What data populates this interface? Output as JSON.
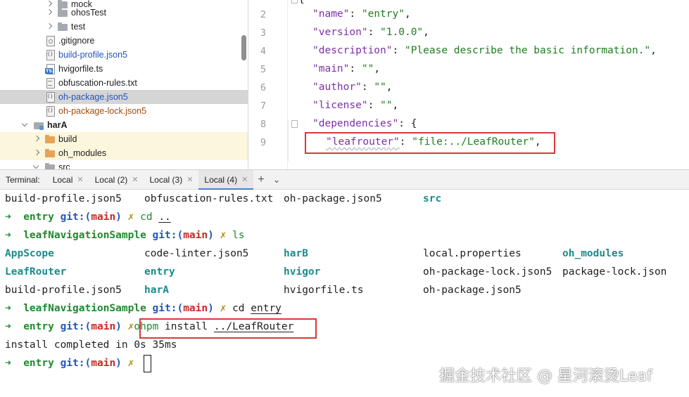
{
  "project_tree": {
    "items": [
      {
        "label": "mock",
        "icon": "folder-grey-icon",
        "arrow": "right",
        "indent": 1
      },
      {
        "label": "ohosTest",
        "icon": "folder-grey-icon",
        "arrow": "right",
        "indent": 1
      },
      {
        "label": "test",
        "icon": "folder-grey-icon",
        "arrow": "right",
        "indent": 1
      },
      {
        "label": ".gitignore",
        "icon": "gitignore-file-icon",
        "arrow": "none",
        "indent": 0
      },
      {
        "label": "build-profile.json5",
        "icon": "json-file-icon",
        "arrow": "none",
        "indent": 0
      },
      {
        "label": "hvigorfile.ts",
        "icon": "ts-file-icon",
        "arrow": "none",
        "indent": 0
      },
      {
        "label": "obfuscation-rules.txt",
        "icon": "text-file-icon",
        "arrow": "none",
        "indent": 0
      },
      {
        "label": "oh-package.json5",
        "icon": "json-file-icon",
        "arrow": "none",
        "indent": 0
      },
      {
        "label": "oh-package-lock.json5",
        "icon": "json-file-icon",
        "arrow": "none",
        "indent": 0
      },
      {
        "label": "harA",
        "icon": "module-folder-icon",
        "arrow": "down",
        "indent": -1
      },
      {
        "label": "build",
        "icon": "folder-orange-icon",
        "arrow": "right",
        "indent": 0
      },
      {
        "label": "oh_modules",
        "icon": "folder-orange-icon",
        "arrow": "right",
        "indent": 0
      },
      {
        "label": "src",
        "icon": "folder-grey-icon",
        "arrow": "down",
        "indent": 0
      }
    ]
  },
  "editor": {
    "line_numbers": [
      "2",
      "3",
      "4",
      "5",
      "6",
      "7",
      "8",
      "9"
    ],
    "lines": [
      {
        "key": "\"name\"",
        "value": "\"entry\"",
        "tail": ","
      },
      {
        "key": "\"version\"",
        "value": "\"1.0.0\"",
        "tail": ","
      },
      {
        "key": "\"description\"",
        "value": "\"Please describe the basic information.\"",
        "tail": ","
      },
      {
        "key": "\"main\"",
        "value": "\"\"",
        "tail": ","
      },
      {
        "key": "\"author\"",
        "value": "\"\"",
        "tail": ","
      },
      {
        "key": "\"license\"",
        "value": "\"\"",
        "tail": ","
      },
      {
        "key": "\"dependencies\"",
        "value": "{",
        "tail": ""
      },
      {
        "key": "\"leafrouter\"",
        "value": "\"file:../LeafRouter\"",
        "tail": ","
      }
    ],
    "top_brace": "{"
  },
  "terminal_tabs": {
    "title": "Terminal:",
    "tabs": [
      {
        "label": "Local",
        "active": false
      },
      {
        "label": "Local (2)",
        "active": false
      },
      {
        "label": "Local (3)",
        "active": false
      },
      {
        "label": "Local (4)",
        "active": true
      }
    ],
    "add": "+",
    "menu": "⌄"
  },
  "terminal": {
    "ls1": [
      "build-profile.json5",
      "obfuscation-rules.txt",
      "oh-package.json5",
      "src"
    ],
    "p1": {
      "arrow": "➜",
      "dir": "entry",
      "git": "git:(",
      "branch": "main",
      "close": ")",
      "x": "✗",
      "cmd": "cd",
      "arg": ".."
    },
    "p2": {
      "arrow": "➜",
      "dir": "leafNavigationSample",
      "git": "git:(",
      "branch": "main",
      "close": ")",
      "x": "✗",
      "cmd": "ls"
    },
    "ls2": {
      "row1": [
        "AppScope",
        "code-linter.json5",
        "harB",
        "local.properties",
        "oh_modules"
      ],
      "row2": [
        "LeafRouter",
        "entry",
        "hvigor",
        "oh-package-lock.json5",
        "package-lock.json"
      ],
      "row3": [
        "build-profile.json5",
        "harA",
        "hvigorfile.ts",
        "oh-package.json5"
      ]
    },
    "p3": {
      "arrow": "➜",
      "dir": "leafNavigationSample",
      "git": "git:(",
      "branch": "main",
      "close": ")",
      "x": "✗",
      "cmd": "cd",
      "arg": "entry"
    },
    "p4": {
      "arrow": "➜",
      "dir": "entry",
      "git": "git:(",
      "branch": "main",
      "close": ")",
      "x": "✗",
      "cmd": "ohpm",
      "cmd_rest": "install",
      "arg": "../LeafRouter"
    },
    "output": "install completed in 0s 35ms",
    "p5": {
      "arrow": "➜",
      "dir": "entry",
      "git": "git:(",
      "branch": "main",
      "close": ")",
      "x": "✗"
    }
  },
  "watermark": "掘金技术社区 @ 星河滚烫Leaf"
}
